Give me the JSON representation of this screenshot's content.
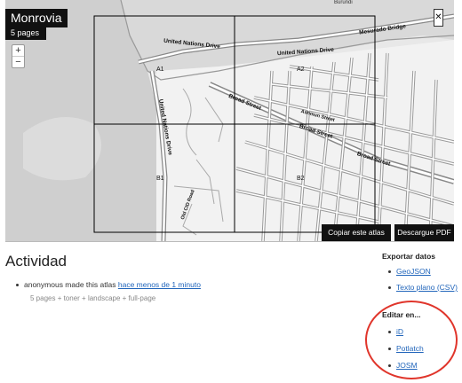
{
  "map": {
    "title": "Monrovia",
    "pages": "5 pages",
    "zoom_in": "+",
    "zoom_out": "−",
    "close": "✕",
    "grid_labels": [
      "A1",
      "A2",
      "B1",
      "B2"
    ],
    "street_labels": [
      "United Nations Drive",
      "United Nations Drive",
      "Mesurado Bridge",
      "Broad Street",
      "Broad Street",
      "Broad Street",
      "Ashmun Street",
      "United Nations Drive",
      "Old CID Road",
      "Burundi"
    ],
    "copy_button": "Copiar este atlas",
    "download_button": "Descargue PDF"
  },
  "activity": {
    "heading": "Actividad",
    "entry_text": "anonymous made this atlas",
    "entry_link": "hace menos de 1 minuto",
    "entry_meta": "5 pages + toner + landscape + full-page"
  },
  "export": {
    "heading": "Exportar datos",
    "items": [
      "GeoJSON",
      "Texto plano (CSV)"
    ]
  },
  "edit": {
    "heading": "Editar en...",
    "items": [
      "iD",
      "Potlatch",
      "JOSM"
    ]
  }
}
